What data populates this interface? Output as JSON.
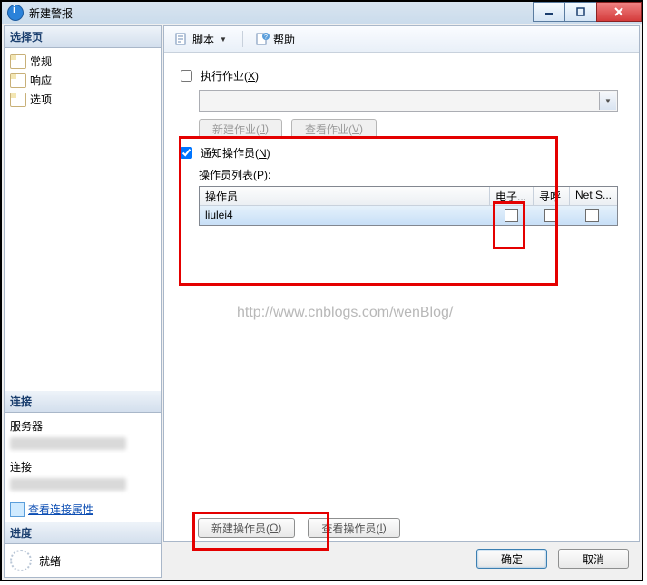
{
  "window": {
    "title": "新建警报"
  },
  "sidebar": {
    "header": "选择页",
    "items": [
      {
        "label": "常规"
      },
      {
        "label": "响应"
      },
      {
        "label": "选项"
      }
    ],
    "connection_header": "连接",
    "server_label": "服务器",
    "target_label": "连接",
    "view_props_link": "查看连接属性",
    "progress_header": "进度",
    "progress_status": "就绪"
  },
  "toolbar": {
    "script_label": "脚本",
    "help_label": "帮助"
  },
  "form": {
    "execute_job_label_pre": "执行作业(",
    "execute_job_label_key": "X",
    "execute_job_label_post": ")",
    "new_job_btn_pre": "新建作业(",
    "new_job_btn_key": "J",
    "new_job_btn_post": ")",
    "view_job_btn_pre": "查看作业(",
    "view_job_btn_key": "V",
    "view_job_btn_post": ")",
    "notify_label_pre": "通知操作员(",
    "notify_label_key": "N",
    "notify_label_post": ")",
    "operator_list_label_pre": "操作员列表(",
    "operator_list_label_key": "P",
    "operator_list_label_post": "):",
    "columns": {
      "c1": "操作员",
      "c2": "电子...",
      "c3": "寻呼",
      "c4": "Net S..."
    },
    "row1": {
      "name": "liulei4"
    },
    "new_operator_btn_pre": "新建操作员(",
    "new_operator_btn_key": "O",
    "new_operator_btn_post": ")",
    "view_operator_btn_pre": "查看操作员(",
    "view_operator_btn_key": "I",
    "view_operator_btn_post": ")"
  },
  "watermark": "http://www.cnblogs.com/wenBlog/",
  "footer": {
    "ok": "确定",
    "cancel": "取消"
  }
}
